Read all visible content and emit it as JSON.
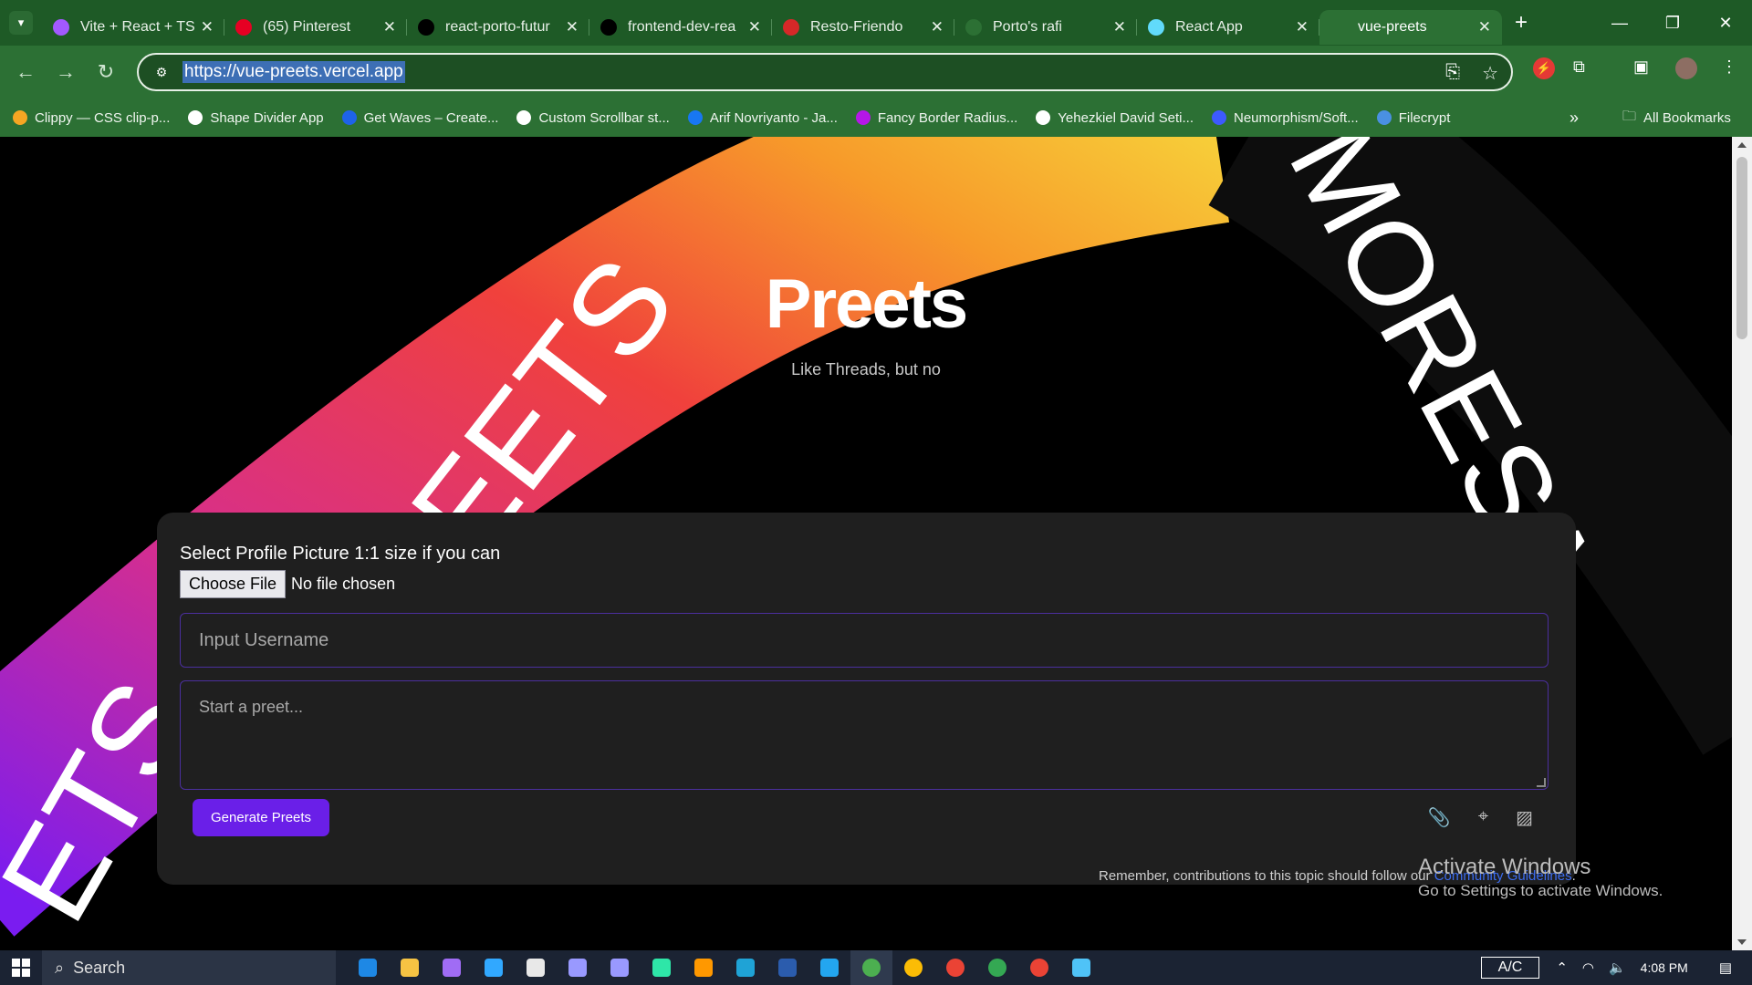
{
  "browser": {
    "tabs": [
      {
        "title": "Vite + React + TS",
        "favicon": "vite-icon",
        "color": "#a259ff",
        "active": false
      },
      {
        "title": "(65) Pinterest",
        "favicon": "pinterest-icon",
        "color": "#e60023",
        "active": false
      },
      {
        "title": "react-porto-futur",
        "favicon": "vercel-icon",
        "color": "#000000",
        "active": false
      },
      {
        "title": "frontend-dev-rea",
        "favicon": "vercel-icon",
        "color": "#000000",
        "active": false
      },
      {
        "title": "Resto-Friendo",
        "favicon": "fork-icon",
        "color": "#d62828",
        "active": false
      },
      {
        "title": "Porto's rafi",
        "favicon": "threads-icon",
        "color": "#2c7034",
        "active": false
      },
      {
        "title": "React App",
        "favicon": "react-icon",
        "color": "#61dafb",
        "active": false
      },
      {
        "title": "vue-preets",
        "favicon": "threads-icon",
        "color": "#2c7034",
        "active": true
      }
    ],
    "address": {
      "url": "https://vue-preets.vercel.app"
    },
    "bookmarks": [
      {
        "label": "Clippy — CSS clip-p...",
        "color": "#f5a623"
      },
      {
        "label": "Shape Divider App",
        "color": "#ffffff"
      },
      {
        "label": "Get Waves – Create...",
        "color": "#1e63e9"
      },
      {
        "label": "Custom Scrollbar st...",
        "color": "#ffffff"
      },
      {
        "label": "Arif Novriyanto - Ja...",
        "color": "#1877f2"
      },
      {
        "label": "Fancy Border Radius...",
        "color": "#b517e8"
      },
      {
        "label": "Yehezkiel David Seti...",
        "color": "#ffffff"
      },
      {
        "label": "Neumorphism/Soft...",
        "color": "#3d5afe"
      },
      {
        "label": "Filecrypt",
        "color": "#4a90e2"
      }
    ],
    "bookmarks_more": "»",
    "all_bookmarks": "All Bookmarks"
  },
  "page": {
    "title": "Preets",
    "subtitle": "Like Threads, but no",
    "background_ribbons": {
      "left_text": "EETS",
      "bottom_text": "ETS",
      "right_text": "MORESA",
      "ribbon_colors": [
        "#7a1cf0",
        "#d62e8e",
        "#f0413c",
        "#f79a2a",
        "#f7d23a"
      ]
    },
    "form": {
      "profile_label": "Select Profile Picture 1:1 size if you can",
      "choose_file_label": "Choose File",
      "file_status": "No file chosen",
      "username_placeholder": "Input Username",
      "preet_placeholder": "Start a preet...",
      "generate_label": "Generate Preets"
    },
    "footer_note_prefix": "Remember, contributions to this topic should follow our ",
    "footer_note_link": "Community Guidelines",
    "footer_note_suffix": ".",
    "accent_color": "#6a1fe8"
  },
  "overlay": {
    "activate_title": "Activate Windows",
    "activate_sub": "Go to Settings to activate Windows."
  },
  "taskbar": {
    "search_label": "Search",
    "ac_label": "A/C",
    "time": "4:08 PM",
    "apps": [
      {
        "name": "mail-icon",
        "color": "#1e88e5"
      },
      {
        "name": "file-explorer-icon",
        "color": "#f6c343"
      },
      {
        "name": "copilot-icon",
        "color": "#a06cf5"
      },
      {
        "name": "photoshop-icon",
        "color": "#31a8ff"
      },
      {
        "name": "notes-icon",
        "color": "#e8e8e8"
      },
      {
        "name": "premiere-icon",
        "color": "#9999ff"
      },
      {
        "name": "after-effects-icon",
        "color": "#9999ff"
      },
      {
        "name": "audition-icon",
        "color": "#2ee6a8"
      },
      {
        "name": "sublime-icon",
        "color": "#ff9800"
      },
      {
        "name": "edge-icon",
        "color": "#1fa3d6"
      },
      {
        "name": "word-icon",
        "color": "#2b5cad"
      },
      {
        "name": "vscode-icon",
        "color": "#23a6f0"
      },
      {
        "name": "chrome-icon",
        "color": "#4caf50"
      },
      {
        "name": "chrome-icon",
        "color": "#fbbc05"
      },
      {
        "name": "chrome-icon",
        "color": "#ea4335"
      },
      {
        "name": "chrome-icon",
        "color": "#34a853"
      },
      {
        "name": "chrome-icon",
        "color": "#ea4335"
      },
      {
        "name": "snipping-icon",
        "color": "#4fc3f7"
      }
    ]
  }
}
